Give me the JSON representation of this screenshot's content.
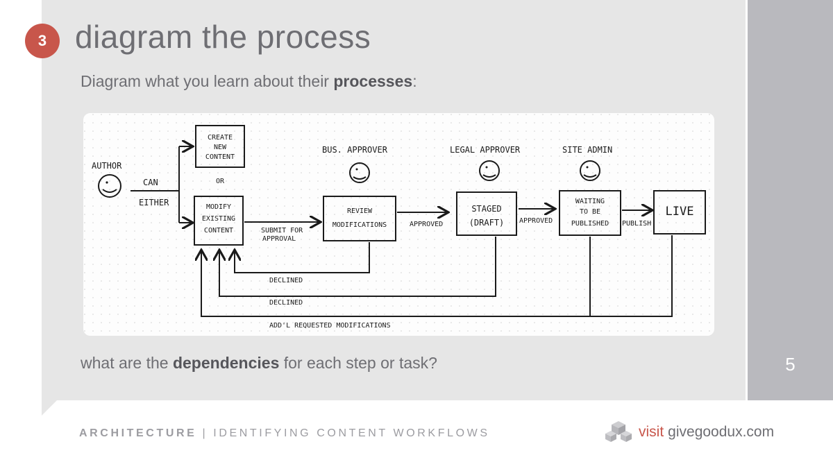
{
  "header": {
    "step_number": "3",
    "title": "diagram the process",
    "subtitle_prefix": "Diagram what you learn about their ",
    "subtitle_bold": "processes",
    "subtitle_suffix": ":"
  },
  "question": {
    "prefix": "what are the ",
    "bold": "dependencies",
    "suffix": " for each step or task?"
  },
  "page_number": "5",
  "footer": {
    "left_bold": "ARCHITECTURE",
    "left_rest": " | IDENTIFYING CONTENT WORKFLOWS",
    "visit": "visit",
    "site": "givegoodux.com"
  },
  "sketch": {
    "roles": {
      "author": "AUTHOR",
      "bus_approver": "BUS. APPROVER",
      "legal_approver": "LEGAL APPROVER",
      "site_admin": "SITE ADMIN"
    },
    "boxes": {
      "create": [
        "CREATE",
        "NEW",
        "CONTENT"
      ],
      "modify": [
        "MODIFY",
        "EXISTING",
        "CONTENT"
      ],
      "review": [
        "REVIEW",
        "MODIFICATIONS"
      ],
      "staged": [
        "STAGED",
        "(DRAFT)"
      ],
      "waiting": [
        "WAITING",
        "TO BE",
        "PUBLISHED"
      ],
      "live": "LIVE"
    },
    "labels": {
      "can": "CAN",
      "either": "EITHER",
      "or": "OR",
      "submit": [
        "SUBMIT FOR",
        "APPROVAL"
      ],
      "approved1": "APPROVED",
      "approved2": "APPROVED",
      "publish": "PUBLISH",
      "declined1": "DECLINED",
      "declined2": "DECLINED",
      "add_mods": "ADD'L REQUESTED MODIFICATIONS"
    }
  }
}
